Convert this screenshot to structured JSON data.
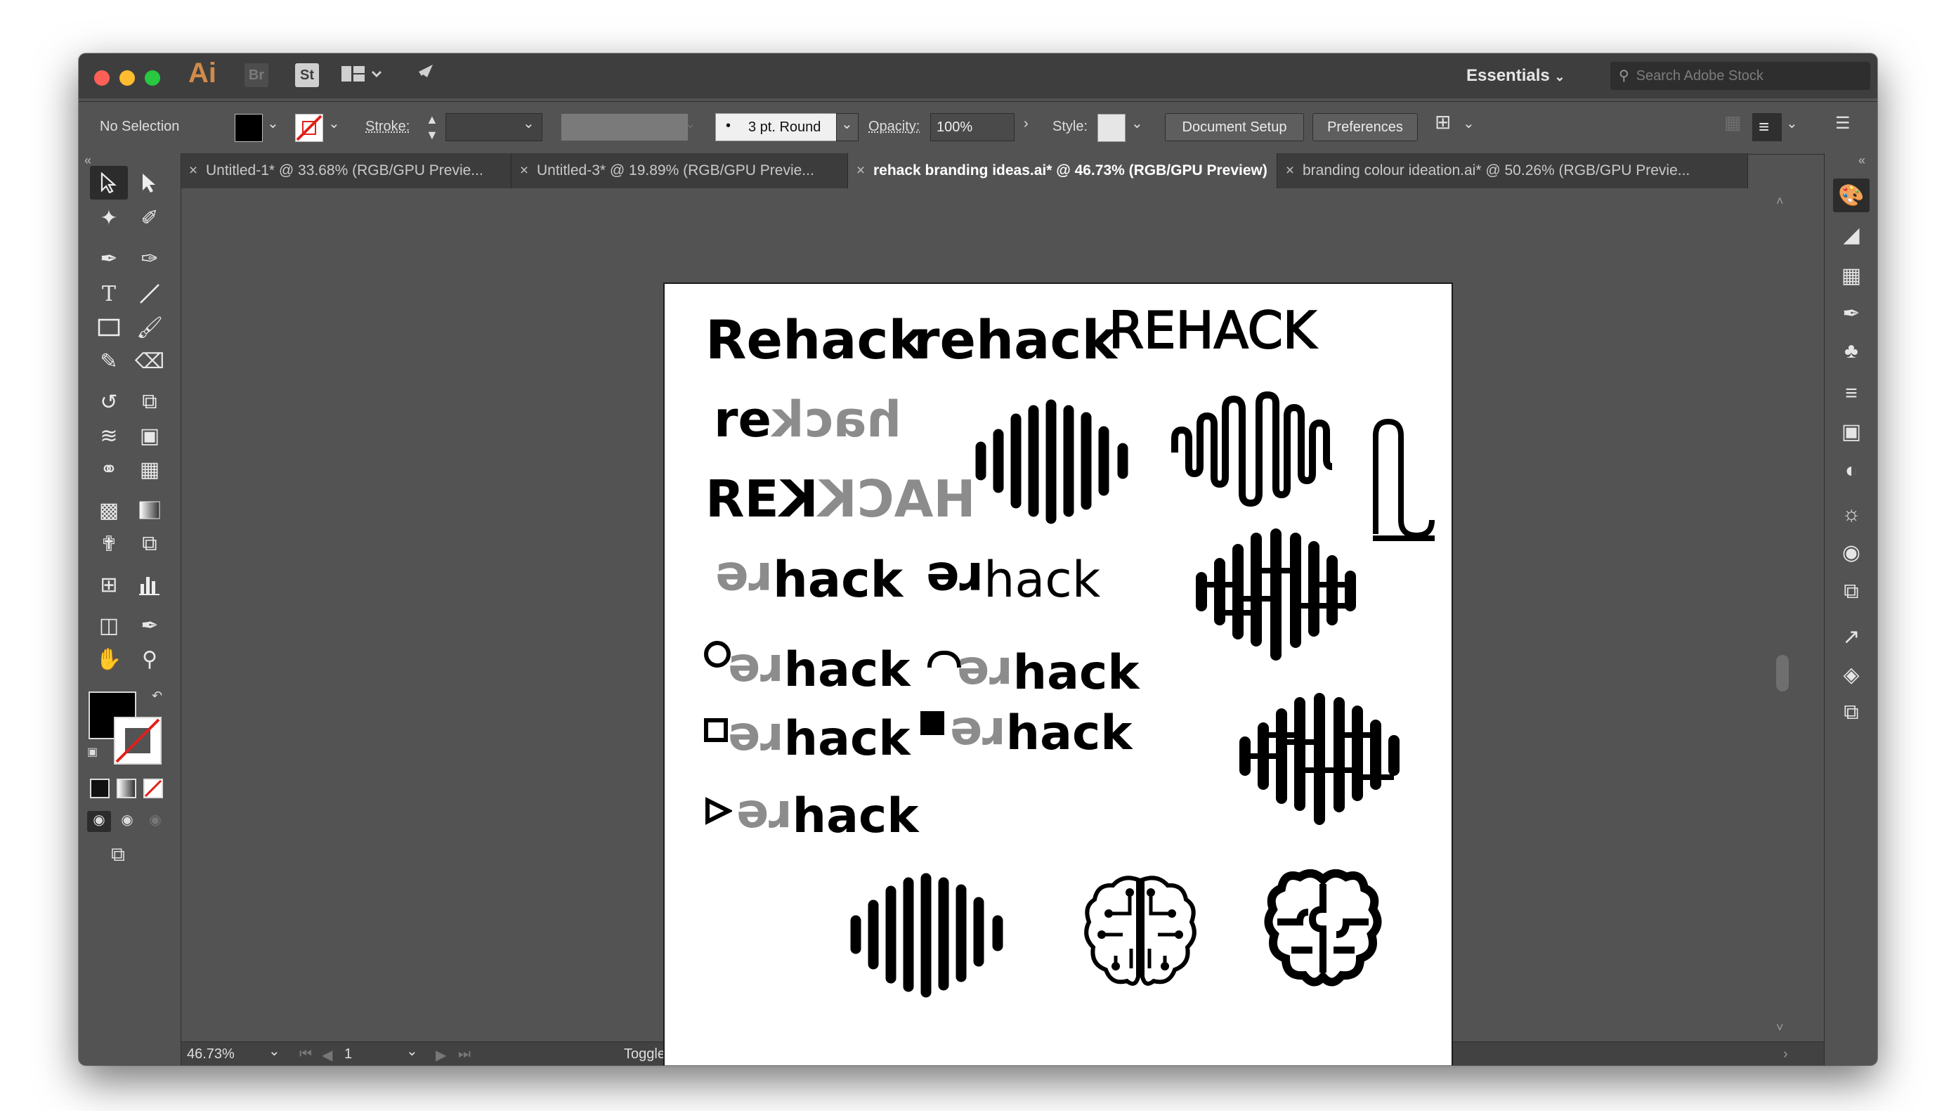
{
  "app": {
    "logo": "Ai",
    "bridge": "Br",
    "stock": "St"
  },
  "workspace": {
    "label": "Essentials"
  },
  "search": {
    "placeholder": "Search Adobe Stock"
  },
  "control_bar": {
    "selection_label": "No Selection",
    "stroke_label": "Stroke:",
    "brush_value": "3 pt. Round",
    "opacity_label": "Opacity:",
    "opacity_value": "100%",
    "style_label": "Style:",
    "document_setup": "Document Setup",
    "preferences": "Preferences"
  },
  "tabs": [
    {
      "label": "Untitled-1* @ 33.68% (RGB/GPU Previe..."
    },
    {
      "label": "Untitled-3* @ 19.89% (RGB/GPU Previe..."
    },
    {
      "label": "rehack branding ideas.ai* @ 46.73% (RGB/GPU Preview)"
    },
    {
      "label": "branding colour ideation.ai* @ 50.26% (RGB/GPU Previe..."
    }
  ],
  "status_bar": {
    "zoom": "46.73%",
    "artboard_number": "1",
    "tool_status": "Toggle Direct Selection"
  },
  "artwork": {
    "word_title_case": "Rehack",
    "word_lower": "rehack",
    "word_upper": "REHACK",
    "mirror_lower_black": "re",
    "mirror_lower_gray": "hack",
    "mirror_upper_black": "RE",
    "mirror_upper_k": "K",
    "mirror_upper_gray": "HACK",
    "flipped_re": "re",
    "hack": "hack"
  },
  "colors": {
    "window_bg": "#535353",
    "titlebar": "#3e3e3e",
    "accent_ai": "#d08b4a",
    "close": "#fe5f57",
    "minimize": "#febc2e",
    "zoom": "#28c840"
  },
  "icons": {
    "tools": [
      "selection-icon",
      "direct-selection-icon",
      "magic-wand-icon",
      "lasso-icon",
      "pen-icon",
      "curvature-icon",
      "type-icon",
      "line-icon",
      "rectangle-icon",
      "paintbrush-icon",
      "shaper-icon",
      "eraser-icon",
      "rotate-icon",
      "scale-icon",
      "width-icon",
      "free-transform-icon",
      "shape-builder-icon",
      "perspective-grid-icon",
      "mesh-icon",
      "gradient-icon",
      "eyedropper-icon",
      "blend-icon",
      "symbol-sprayer-icon",
      "column-graph-icon",
      "artboard-icon",
      "slice-icon",
      "hand-icon",
      "zoom-icon"
    ],
    "right_panel": [
      "color-guide-icon",
      "color-panel-icon",
      "swatches-icon",
      "brushes-icon",
      "symbols-icon",
      "stroke-icon",
      "gradient-panel-icon",
      "transparency-icon",
      "cc-libraries-icon",
      "appearance-icon",
      "graphic-styles-icon",
      "export-icon",
      "layers-icon",
      "artboards-icon"
    ]
  }
}
